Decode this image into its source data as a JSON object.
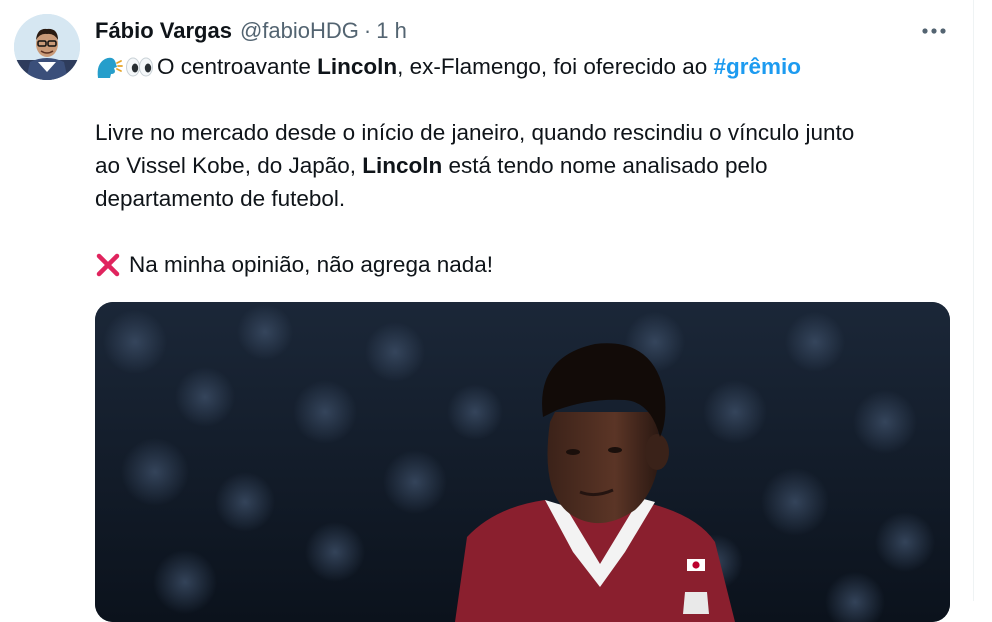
{
  "tweet": {
    "author": {
      "display_name": "Fábio Vargas",
      "handle": "@fabioHDG"
    },
    "separator": "·",
    "timestamp": "1 h",
    "icons": [
      "speaking-head-emoji",
      "eyes-emoji",
      "cross-mark-emoji",
      "more-icon"
    ],
    "text": {
      "line1_pre": "O centroavante ",
      "line1_bold": "Lincoln",
      "line1_post": ", ex-Flamengo, foi oferecido ao ",
      "hashtag": "#grêmio",
      "p2_line1": "Livre no mercado desde o início de janeiro, quando rescindiu o vínculo junto",
      "p2_line2_pre": "ao Vissel Kobe, do Japão, ",
      "p2_line2_bold": "Lincoln",
      "p2_line2_post": " está tendo nome analisado pelo",
      "p2_line3": "departamento de futebol.",
      "opinion": "Na minha opinião, não agrega nada!"
    },
    "colors": {
      "hashtag": "#1d9bf0",
      "secondary_text": "#536471",
      "cross_mark": "#e0245e",
      "jersey": "#8a1f2e"
    }
  }
}
